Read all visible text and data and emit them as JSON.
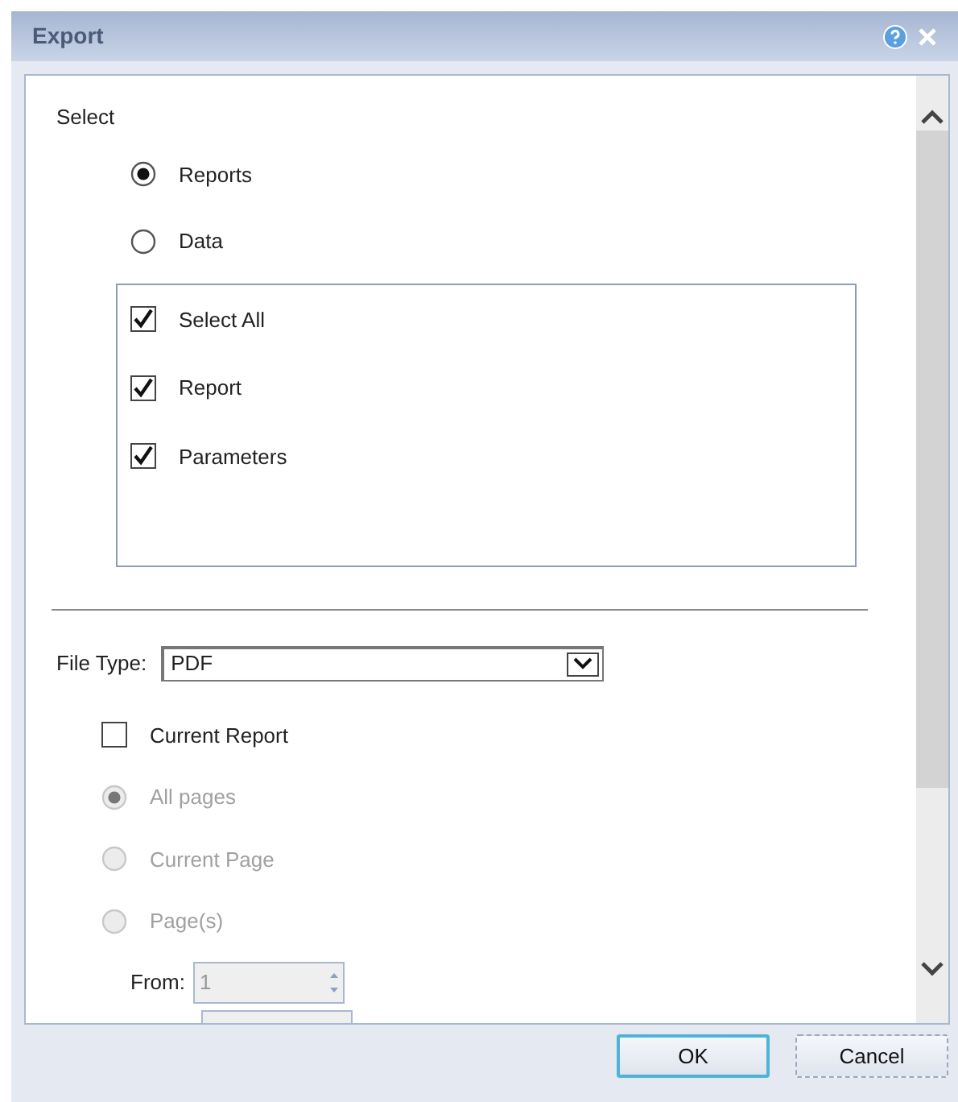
{
  "dialog": {
    "title": "Export"
  },
  "select": {
    "label": "Select",
    "options": [
      {
        "label": "Reports",
        "selected": true
      },
      {
        "label": "Data",
        "selected": false
      }
    ],
    "items": [
      {
        "label": "Select All",
        "checked": true
      },
      {
        "label": "Report",
        "checked": true
      },
      {
        "label": "Parameters",
        "checked": true
      }
    ]
  },
  "file_type": {
    "label": "File Type:",
    "value": "PDF"
  },
  "current_report": {
    "label": "Current Report",
    "checked": false
  },
  "pages": {
    "disabled": true,
    "options": [
      {
        "label": "All pages",
        "selected": true
      },
      {
        "label": "Current Page",
        "selected": false
      },
      {
        "label": "Page(s)",
        "selected": false
      }
    ]
  },
  "from": {
    "label": "From:",
    "value": "1",
    "disabled": true
  },
  "buttons": [
    {
      "label": "OK",
      "default": true
    },
    {
      "label": "Cancel",
      "default": false
    }
  ]
}
